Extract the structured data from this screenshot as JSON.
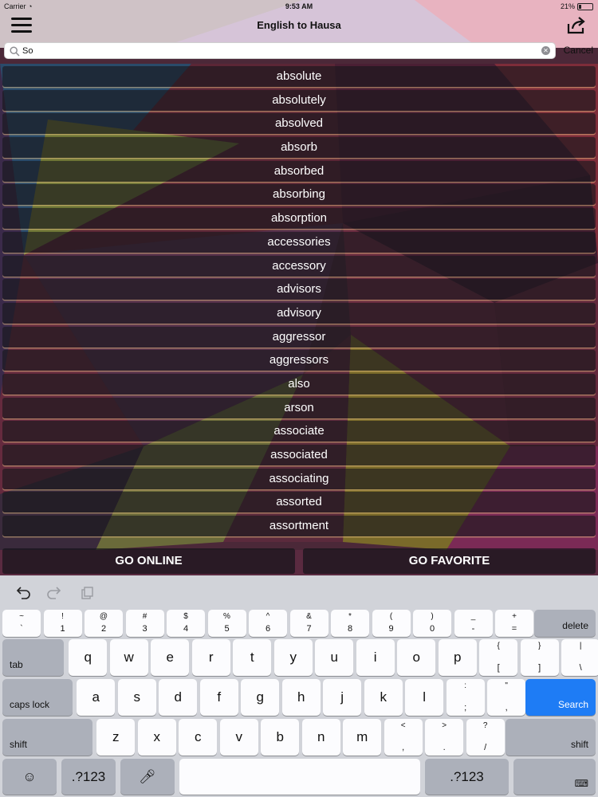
{
  "status_bar": {
    "carrier": "Carrier",
    "time": "9:53 AM",
    "battery": "21%",
    "battery_level": 0.21
  },
  "navbar": {
    "title": "English to Hausa"
  },
  "search": {
    "value": "So",
    "cancel_label": "Cancel"
  },
  "words": [
    "absolute",
    "absolutely",
    "absolved",
    "absorb",
    "absorbed",
    "absorbing",
    "absorption",
    "accessories",
    "accessory",
    "advisors",
    "advisory",
    "aggressor",
    "aggressors",
    "also",
    "arson",
    "associate",
    "associated",
    "associating",
    "assorted",
    "assortment"
  ],
  "bottom_buttons": {
    "go_online": "GO ONLINE",
    "go_favorite": "GO FAVORITE"
  },
  "keyboard": {
    "row_numbers": [
      {
        "top": "~",
        "bottom": "`"
      },
      {
        "top": "!",
        "bottom": "1"
      },
      {
        "top": "@",
        "bottom": "2"
      },
      {
        "top": "#",
        "bottom": "3"
      },
      {
        "top": "$",
        "bottom": "4"
      },
      {
        "top": "%",
        "bottom": "5"
      },
      {
        "top": "^",
        "bottom": "6"
      },
      {
        "top": "&",
        "bottom": "7"
      },
      {
        "top": "*",
        "bottom": "8"
      },
      {
        "top": "(",
        "bottom": "9"
      },
      {
        "top": ")",
        "bottom": "0"
      },
      {
        "top": "_",
        "bottom": "-"
      },
      {
        "top": "+",
        "bottom": "="
      }
    ],
    "delete_label": "delete",
    "tab_label": "tab",
    "row_qwerty": [
      "q",
      "w",
      "e",
      "r",
      "t",
      "y",
      "u",
      "i",
      "o",
      "p"
    ],
    "row_qwerty_symbols": [
      {
        "top": "{",
        "bottom": "["
      },
      {
        "top": "}",
        "bottom": "]"
      },
      {
        "top": "|",
        "bottom": "\\"
      }
    ],
    "caps_label": "caps lock",
    "row_asdf": [
      "a",
      "s",
      "d",
      "f",
      "g",
      "h",
      "j",
      "k",
      "l"
    ],
    "row_asdf_symbols": [
      {
        "top": ":",
        "bottom": ";"
      },
      {
        "top": "\"",
        "bottom": ","
      }
    ],
    "search_label": "Search",
    "shift_label": "shift",
    "row_zxcv": [
      "z",
      "x",
      "c",
      "v",
      "b",
      "n",
      "m"
    ],
    "row_zxcv_symbols": [
      {
        "top": "<",
        "bottom": ","
      },
      {
        "top": ">",
        "bottom": "."
      },
      {
        "top": "?",
        "bottom": "/"
      }
    ],
    "numbers_label": ".?123"
  },
  "icons": {
    "menu": "hamburger-menu-icon",
    "share": "share-icon",
    "search": "magnifier-icon",
    "clear": "clear-icon",
    "undo": "undo-icon",
    "redo": "redo-icon",
    "paste": "paste-icon",
    "emoji": "emoji-icon",
    "mic": "microphone-icon",
    "hide_keyboard": "keyboard-hide-icon"
  }
}
